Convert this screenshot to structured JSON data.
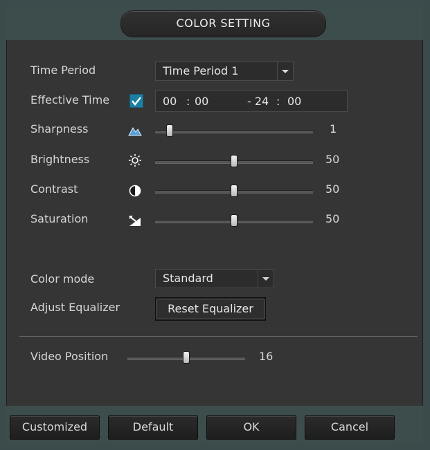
{
  "title": "COLOR SETTING",
  "time_period": {
    "label": "Time Period",
    "value": "Time Period 1"
  },
  "effective_time": {
    "label": "Effective Time",
    "checked": true,
    "start_h": "00",
    "start_sep": ":",
    "start_m": "00",
    "end_h": "- 24",
    "end_sep": ":",
    "end_m": "00"
  },
  "sharpness": {
    "label": "Sharpness",
    "value": "1",
    "fraction": 0.09
  },
  "brightness": {
    "label": "Brightness",
    "value": "50",
    "fraction": 0.5
  },
  "contrast": {
    "label": "Contrast",
    "value": "50",
    "fraction": 0.5
  },
  "saturation": {
    "label": "Saturation",
    "value": "50",
    "fraction": 0.5
  },
  "color_mode": {
    "label": "Color mode",
    "value": "Standard"
  },
  "equalizer": {
    "label": "Adjust Equalizer",
    "button": "Reset Equalizer"
  },
  "video_position": {
    "label": "Video Position",
    "value": "16",
    "fraction": 0.5
  },
  "buttons": {
    "customized": "Customized",
    "default": "Default",
    "ok": "OK",
    "cancel": "Cancel"
  },
  "colors": {
    "checkbox": "#1b7fa3",
    "panel": "#353535",
    "frame": "#3b4a4a"
  }
}
